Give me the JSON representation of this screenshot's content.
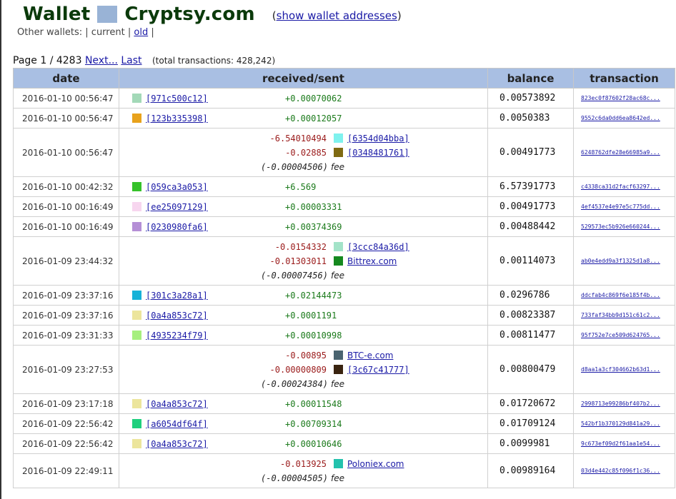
{
  "header": {
    "title_wallet": "Wallet",
    "title_service": "Cryptsy.com",
    "addr_link_open": "(",
    "addr_link_label": "show wallet addresses",
    "addr_link_close": ")",
    "swatch_color": "#99b3d6"
  },
  "other_wallets": {
    "label": "Other wallets:",
    "sep1": "|",
    "current": "current",
    "sep2": "|",
    "old": "old",
    "sep3": "|"
  },
  "pager": {
    "page_label": "Page 1 / 4283",
    "next": "Next...",
    "last": "Last",
    "total": "(total transactions: 428,242)"
  },
  "table": {
    "columns": [
      "date",
      "received/sent",
      "balance",
      "transaction"
    ],
    "rows": [
      {
        "date": "2016-01-10 00:56:47",
        "kind": "in",
        "color": "#a3d9b8",
        "addr": "[971c500c12]",
        "amount": "+0.00070062",
        "balance": "0.00573892",
        "tx": "823ec0f87602f28ac68c..."
      },
      {
        "date": "2016-01-10 00:56:47",
        "kind": "in",
        "color": "#e8a21c",
        "addr": "[123b335398]",
        "amount": "+0.00012057",
        "balance": "0.0050383",
        "tx": "9552c6da0dd6ea8642ed..."
      },
      {
        "date": "2016-01-10 00:56:47",
        "kind": "out",
        "outs": [
          {
            "amount": "-6.54010494",
            "color": "#7ff2ee",
            "addr": "[6354d04bba]"
          },
          {
            "amount": "-0.02885",
            "color": "#7f6a12",
            "addr": "[0348481761]"
          }
        ],
        "fee": "(-0.00004506)",
        "fee_label": "fee",
        "balance": "0.00491773",
        "tx": "6248762dfe28e66985a9..."
      },
      {
        "date": "2016-01-10 00:42:32",
        "kind": "in",
        "color": "#35c22a",
        "addr": "[059ca3a053]",
        "amount": "+6.569",
        "balance": "6.57391773",
        "tx": "c4338ca31d2facf63297..."
      },
      {
        "date": "2016-01-10 00:16:49",
        "kind": "in",
        "color": "#f7d6ef",
        "addr": "[ee25097129]",
        "amount": "+0.00003331",
        "balance": "0.00491773",
        "tx": "4ef4537e4e97e5c775dd..."
      },
      {
        "date": "2016-01-10 00:16:49",
        "kind": "in",
        "color": "#b58fd6",
        "addr": "[0230980fa6]",
        "amount": "+0.00374369",
        "balance": "0.00488442",
        "tx": "529573ec5b926e660244..."
      },
      {
        "date": "2016-01-09 23:44:32",
        "kind": "out",
        "outs": [
          {
            "amount": "-0.0154332",
            "color": "#a3e3c8",
            "addr": "[3ccc84a36d]"
          },
          {
            "amount": "-0.01303011",
            "color": "#15891f",
            "addr": "Bittrex.com",
            "service": true
          }
        ],
        "fee": "(-0.00007456)",
        "fee_label": "fee",
        "balance": "0.00114073",
        "tx": "ab0e4edd9a3f1325d1a8..."
      },
      {
        "date": "2016-01-09 23:37:16",
        "kind": "in",
        "color": "#16b2d8",
        "addr": "[301c3a28a1]",
        "amount": "+0.02144473",
        "balance": "0.0296786",
        "tx": "ddcfab4c869f6e185f4b..."
      },
      {
        "date": "2016-01-09 23:37:16",
        "kind": "in",
        "color": "#ece59c",
        "addr": "[0a4a853c72]",
        "amount": "+0.0001191",
        "balance": "0.00823387",
        "tx": "733faf34bb9d151c61c2..."
      },
      {
        "date": "2016-01-09 23:31:33",
        "kind": "in",
        "color": "#a6ef7e",
        "addr": "[4935234f79]",
        "amount": "+0.00010998",
        "balance": "0.00811477",
        "tx": "95f752e7ce509d624765..."
      },
      {
        "date": "2016-01-09 23:27:53",
        "kind": "out",
        "outs": [
          {
            "amount": "-0.00895",
            "color": "#4a6470",
            "addr": "BTC-e.com",
            "service": true
          },
          {
            "amount": "-0.00000809",
            "color": "#3a2410",
            "addr": "[3c67c41777]"
          }
        ],
        "fee": "(-0.00024384)",
        "fee_label": "fee",
        "balance": "0.00800479",
        "tx": "d8aa1a3cf304662b63d1..."
      },
      {
        "date": "2016-01-09 23:17:18",
        "kind": "in",
        "color": "#ece59c",
        "addr": "[0a4a853c72]",
        "amount": "+0.00011548",
        "balance": "0.01720672",
        "tx": "2998713e99286bf407b2..."
      },
      {
        "date": "2016-01-09 22:56:42",
        "kind": "in",
        "color": "#1fd07e",
        "addr": "[a6054df64f]",
        "amount": "+0.00709314",
        "balance": "0.01709124",
        "tx": "542bf1b370129d841a29..."
      },
      {
        "date": "2016-01-09 22:56:42",
        "kind": "in",
        "color": "#ece59c",
        "addr": "[0a4a853c72]",
        "amount": "+0.00010646",
        "balance": "0.0099981",
        "tx": "9c673ef09d2f61aa1e54..."
      },
      {
        "date": "2016-01-09 22:49:11",
        "kind": "out",
        "outs": [
          {
            "amount": "-0.013925",
            "color": "#23c2ad",
            "addr": "Poloniex.com",
            "service": true
          }
        ],
        "fee": "(-0.00004505)",
        "fee_label": "fee",
        "balance": "0.00989164",
        "tx": "03d4e442c85f096f1c36..."
      }
    ]
  }
}
